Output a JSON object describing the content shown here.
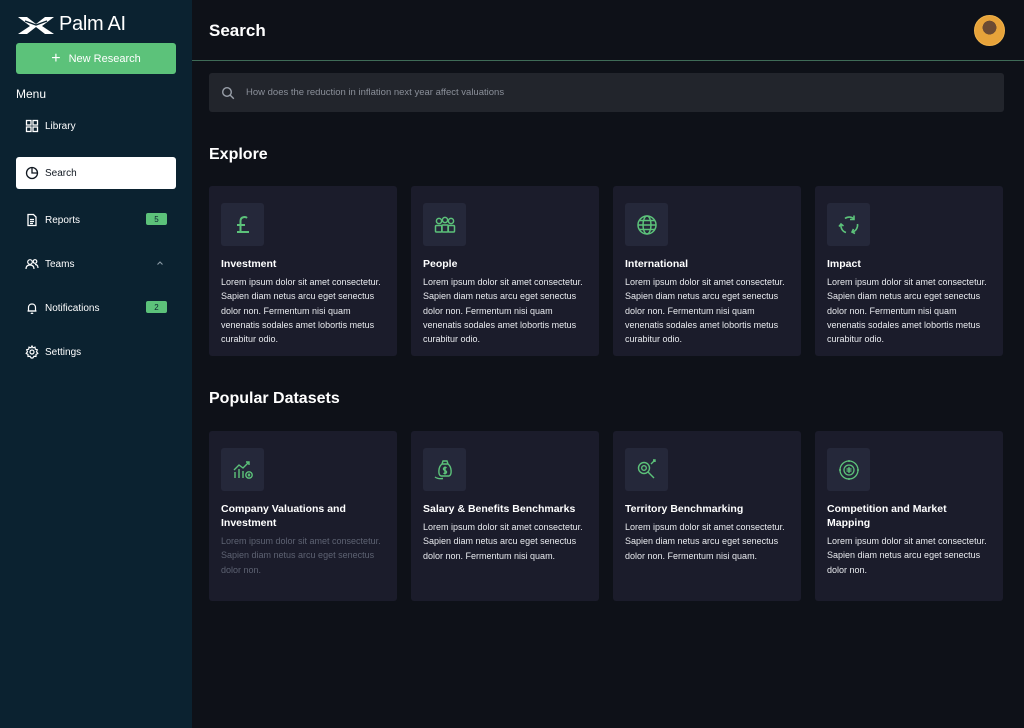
{
  "brand": {
    "name": "Palm AI"
  },
  "sidebar": {
    "new_button": {
      "label": "New Research"
    },
    "menu_label": "Menu",
    "items": [
      {
        "label": "Library"
      },
      {
        "label": "Search"
      },
      {
        "label": "Reports",
        "badge": "5"
      },
      {
        "label": "Teams"
      },
      {
        "label": "Notifications",
        "badge": "2"
      },
      {
        "label": "Settings"
      }
    ]
  },
  "header": {
    "title": "Search"
  },
  "search": {
    "placeholder": "How does the reduction in inflation next year affect valuations"
  },
  "explore": {
    "title": "Explore",
    "cards": [
      {
        "title": "Investment",
        "description": "Lorem ipsum dolor sit amet consectetur. Sapien diam netus arcu eget senectus dolor non. Fermentum nisi quam venenatis sodales amet lobortis metus curabitur odio."
      },
      {
        "title": "People",
        "description": "Lorem ipsum dolor sit amet consectetur. Sapien diam netus arcu eget senectus dolor non. Fermentum nisi quam venenatis sodales amet lobortis metus curabitur odio."
      },
      {
        "title": "International",
        "description": "Lorem ipsum dolor sit amet consectetur. Sapien diam netus arcu eget senectus dolor non. Fermentum nisi quam venenatis sodales amet lobortis metus curabitur odio."
      },
      {
        "title": "Impact",
        "description": "Lorem ipsum dolor sit amet consectetur. Sapien diam netus arcu eget senectus dolor non. Fermentum nisi quam venenatis sodales amet lobortis metus curabitur odio."
      }
    ]
  },
  "datasets": {
    "title": "Popular Datasets",
    "cards": [
      {
        "title": "Company Valuations and Investment",
        "description": "Lorem ipsum dolor sit amet consectetur. Sapien diam netus arcu eget senectus dolor non."
      },
      {
        "title": "Salary & Benefits Benchmarks",
        "description": "Lorem ipsum dolor sit amet consectetur. Sapien diam netus arcu eget senectus dolor non. Fermentum nisi quam."
      },
      {
        "title": "Territory Benchmarking",
        "description": "Lorem ipsum dolor sit amet consectetur. Sapien diam netus arcu eget senectus dolor non. Fermentum nisi quam."
      },
      {
        "title": "Competition and Market Mapping",
        "description": "Lorem ipsum dolor sit amet consectetur. Sapien diam netus arcu eget senectus dolor non."
      }
    ]
  },
  "colors": {
    "accent": "#5cc27a",
    "sidebar_bg": "#0b2230",
    "card_bg": "#1b1c2b",
    "main_bg": "#0e1118"
  }
}
